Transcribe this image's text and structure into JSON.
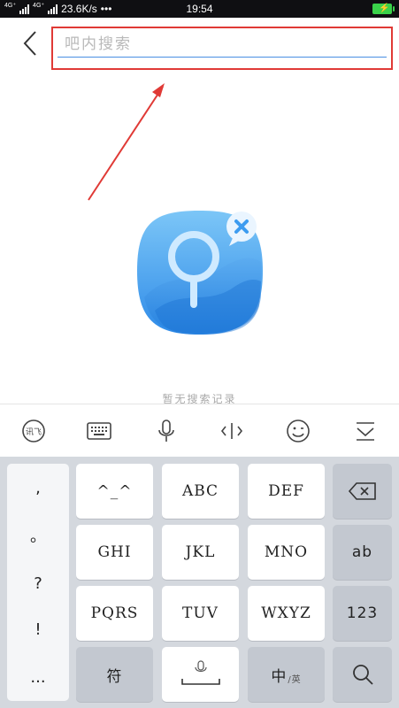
{
  "status_bar": {
    "network_badge": "4G⁺",
    "network_badge2": "4G⁺",
    "speed": "23.6K/s",
    "dots": "•••",
    "time": "19:54"
  },
  "search": {
    "placeholder": "吧内搜索"
  },
  "empty_state": {
    "message": "暂无搜索记录"
  },
  "keyboard": {
    "punctuation": [
      ",",
      "。",
      "?",
      "!",
      "..."
    ],
    "row1": [
      "^_^",
      "ABC",
      "DEF"
    ],
    "row2": [
      "GHI",
      "JKL",
      "MNO",
      "ab"
    ],
    "row3": [
      "PQRS",
      "TUV",
      "WXYZ",
      "123"
    ],
    "symbol_key": "符",
    "lang_key_main": "中",
    "lang_key_sub": "/英"
  },
  "colors": {
    "highlight_box": "#e03a36",
    "input_underline": "#4a8fe2",
    "illustration_blue": "#3d9cf0",
    "battery": "#3ad24a"
  }
}
